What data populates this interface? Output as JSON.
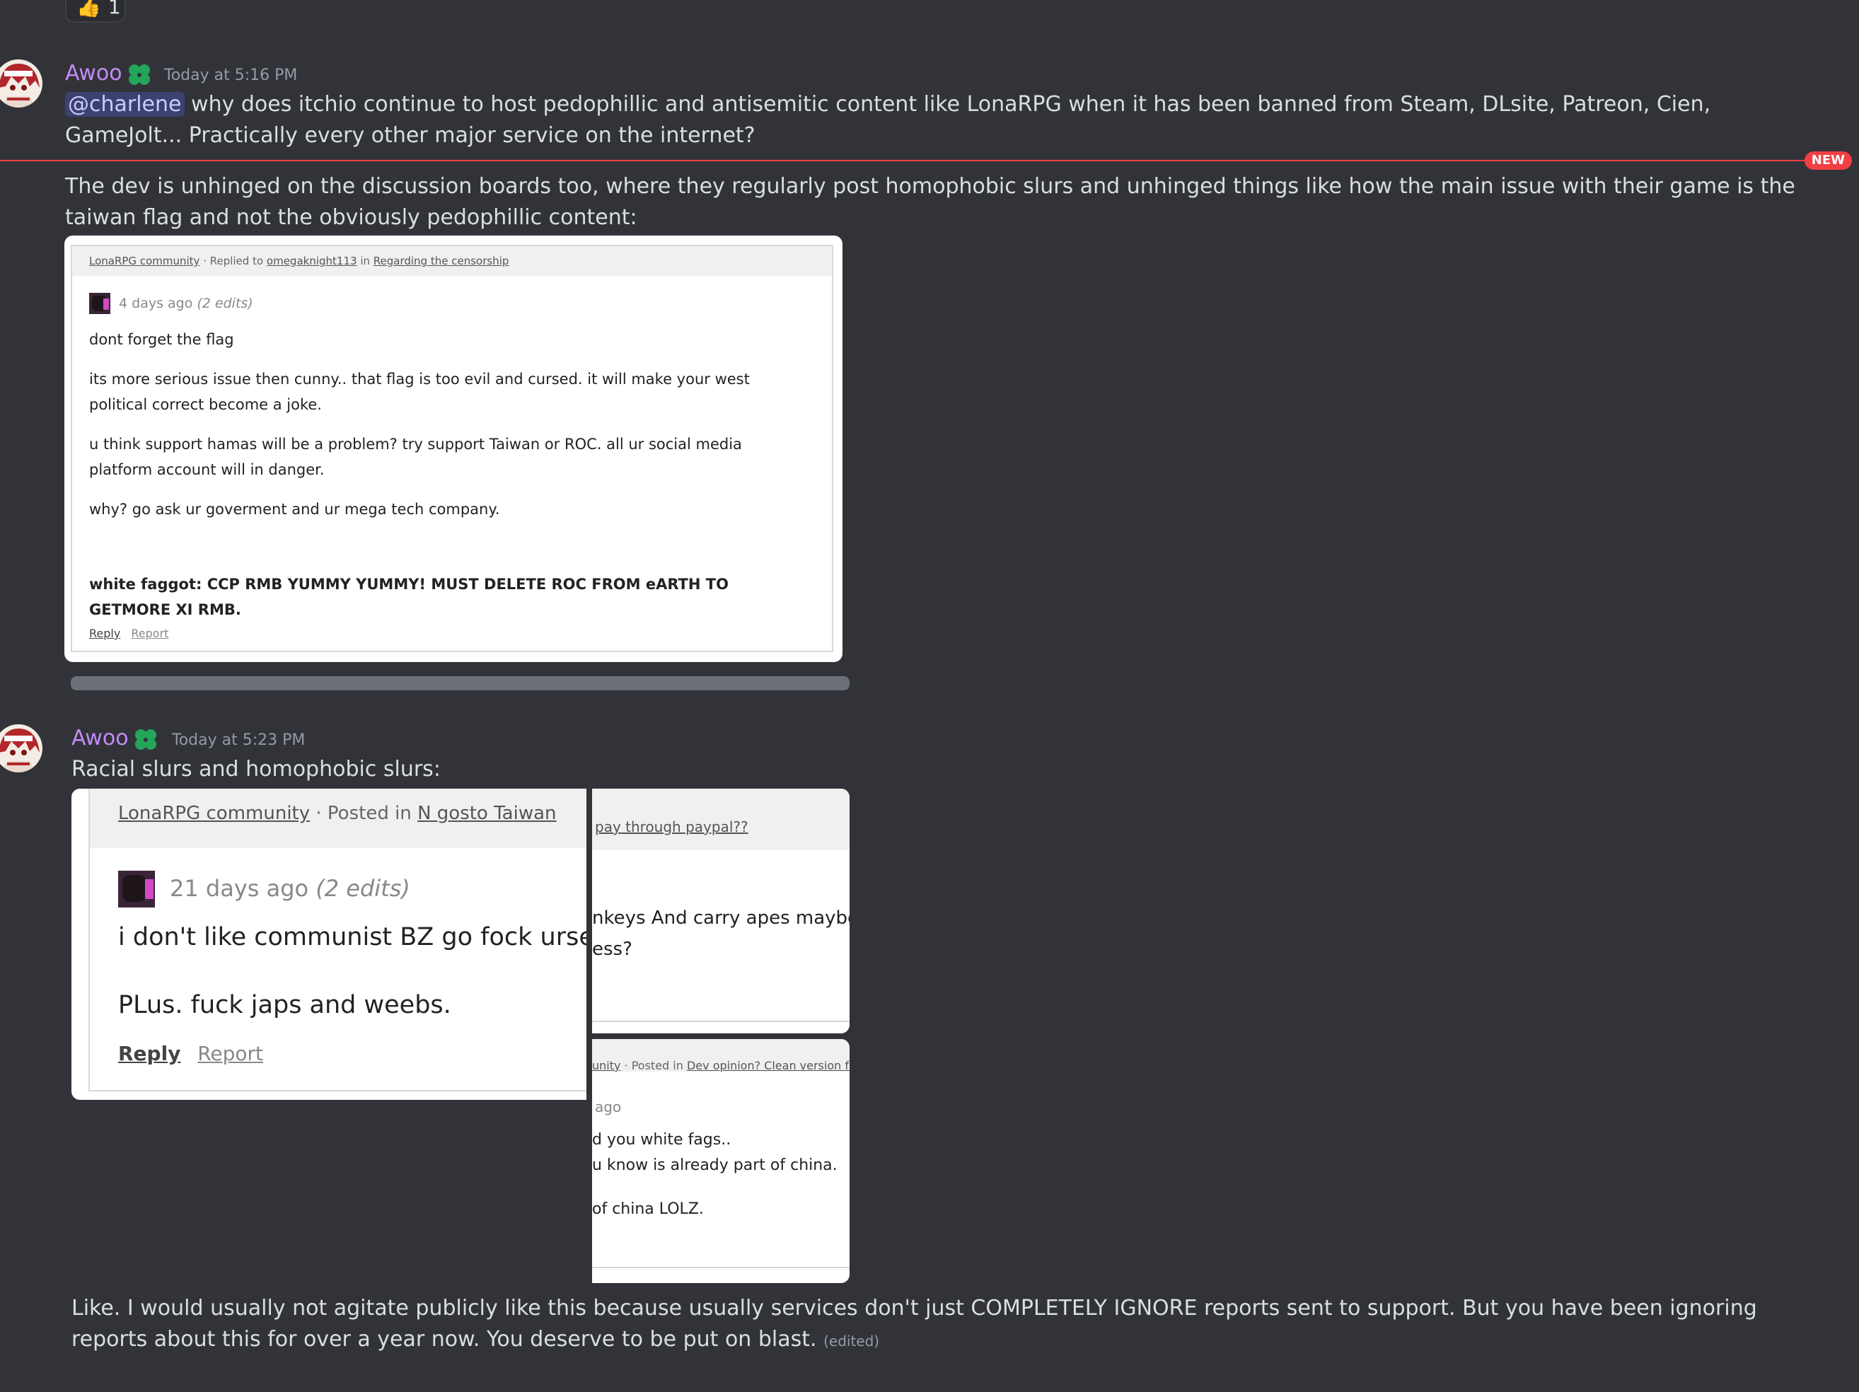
{
  "reaction": {
    "emoji": "👍",
    "count": "1"
  },
  "messages": [
    {
      "username": "Awoo",
      "timestamp": "Today at 5:16 PM",
      "mention": "@charlene",
      "text1": " why does itchio continue to host pedophillic and antisemitic content like LonaRPG when it has been banned from Steam, DLsite, Patreon, Cien, GameJolt... Practically every other major service on the internet?",
      "text2": "The dev is unhinged on the discussion boards too, where they regularly post homophobic slurs and unhinged things like how the main issue with their game is the taiwan flag and not the obviously pedophillic content:"
    },
    {
      "username": "Awoo",
      "timestamp": "Today at 5:23 PM",
      "text1": "Racial slurs and homophobic slurs:",
      "text2": "Like. I would usually not agitate publicly like this because usually services don't just COMPLETELY IGNORE reports sent to support. But you have been ignoring reports about this for over a year now. You deserve to be put on blast.",
      "edited": "(edited)"
    }
  ],
  "new_marker": "NEW",
  "embed1": {
    "community": "LonaRPG community",
    "sep1": " · Replied to ",
    "user": "omegaknight113",
    "sep2": " in ",
    "topic": "Regarding the censorship",
    "age": "4 days ago",
    "edits": "(2 edits)",
    "p1": "dont forget the flag",
    "p2": "its more serious issue then cunny.. that flag is too evil and cursed. it will make your west political correct  become a joke.",
    "p3": "u think support hamas will be a problem?  try support Taiwan or ROC.  all ur social media platform account will in danger.",
    "p4": "why?   go ask ur goverment and ur mega tech company.",
    "p5": "white faggot: CCP RMB YUMMY YUMMY! MUST DELETE ROC FROM eARTH TO GETMORE XI RMB.",
    "reply": "Reply",
    "report": "Report"
  },
  "embed2": {
    "community": "LonaRPG community",
    "sep": " · Posted in ",
    "topic": "N gosto Taiwan",
    "age": "21 days ago",
    "edits": "(2 edits)",
    "p1": "i don't like communist BZ go fock urself.",
    "p2": "PLus.  fuck japs and weebs.",
    "reply": "Reply",
    "report": "Report"
  },
  "embed3": {
    "topic": "pay through paypal??",
    "l1": "nkeys And carry apes maybe?",
    "l2": "ess?"
  },
  "embed4": {
    "community": "unity",
    "sep": " · Posted in ",
    "topic": "Dev opinion? Clean version for",
    "age": "ago",
    "l1": "d you white fags..",
    "l2": "u know is already part of china.",
    "l3": "of china LOLZ."
  }
}
